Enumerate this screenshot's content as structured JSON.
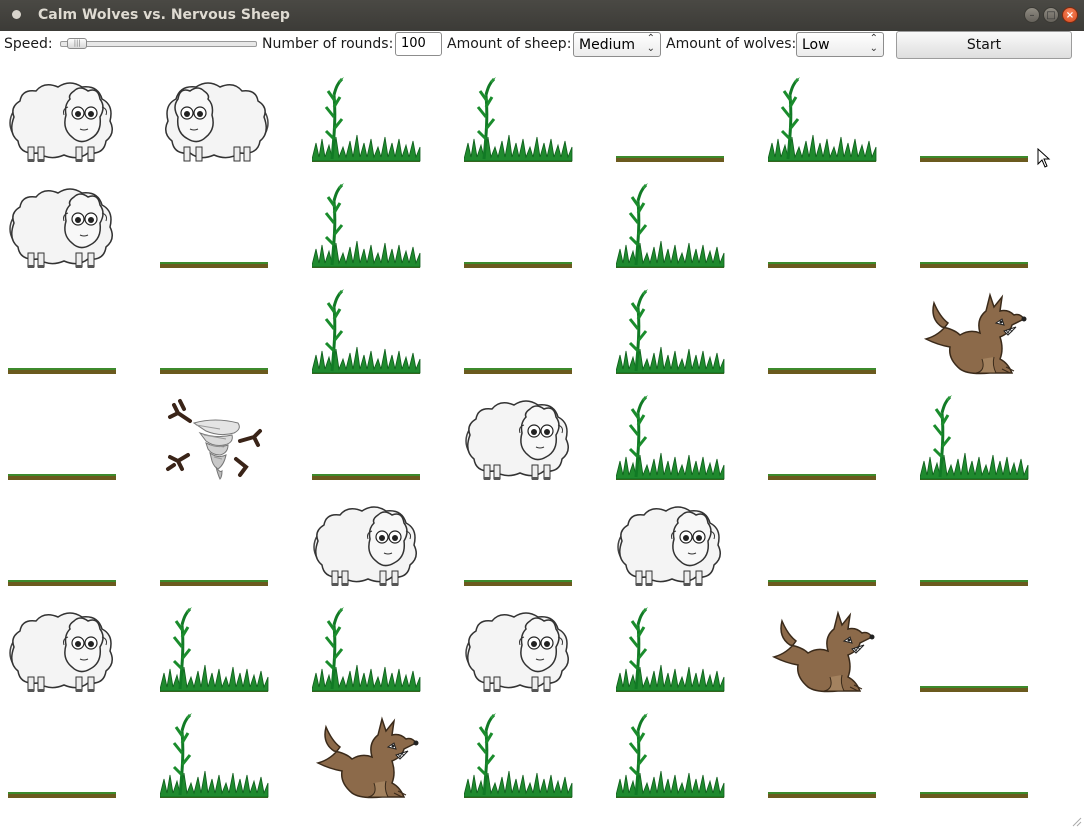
{
  "window": {
    "title": "Calm Wolves vs. Nervous Sheep"
  },
  "controls": {
    "speed_label": "Speed:",
    "speed_value": 0.03,
    "rounds_label": "Number of rounds:",
    "rounds_value": "100",
    "sheep_label": "Amount of sheep:",
    "sheep_selected": "Medium",
    "wolves_label": "Amount of wolves:",
    "wolves_selected": "Low",
    "start_label": "Start"
  },
  "board": {
    "cells": [
      [
        "sheep",
        "sheep",
        "tallgrass",
        "tallgrass",
        "dirt",
        "tallgrass",
        "dirt"
      ],
      [
        "sheep",
        "dirt",
        "tallgrass",
        "dirt",
        "tallgrass",
        "dirt",
        "dirt"
      ],
      [
        "dirt",
        "dirt",
        "tallgrass",
        "dirt",
        "tallgrass",
        "dirt",
        "wolf"
      ],
      [
        "dirt",
        "tornado",
        "dirt",
        "sheep",
        "tallgrass",
        "dirt",
        "tallgrass"
      ],
      [
        "dirt",
        "dirt",
        "sheep",
        "dirt",
        "sheep",
        "dirt",
        "dirt"
      ],
      [
        "sheep",
        "tallgrass",
        "tallgrass",
        "sheep",
        "tallgrass",
        "wolf",
        "dirt"
      ],
      [
        "dirt",
        "tallgrass",
        "wolf",
        "tallgrass",
        "tallgrass",
        "dirt",
        "dirt"
      ]
    ]
  }
}
